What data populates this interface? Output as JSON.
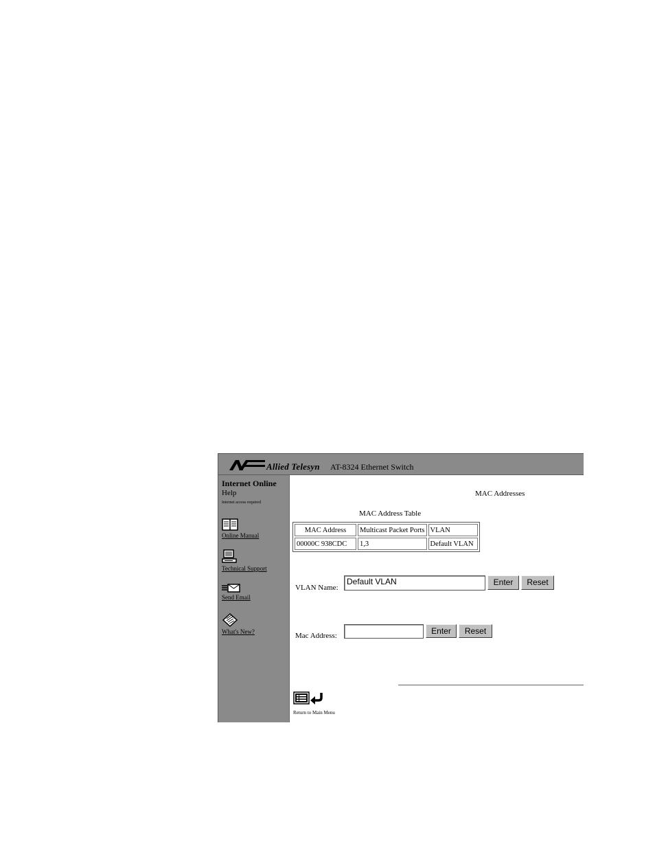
{
  "header": {
    "brand": "Allied Telesyn",
    "product": "AT-8324 Ethernet Switch"
  },
  "sidebar": {
    "title": "Internet Online",
    "subtitle": "Help",
    "note": "Internet access required",
    "items": [
      {
        "label": "Online Manual",
        "icon": "book-icon"
      },
      {
        "label": "Technical Support",
        "icon": "computer-icon"
      },
      {
        "label": "Send Email",
        "icon": "envelope-icon"
      },
      {
        "label": "What's New?",
        "icon": "news-icon"
      }
    ]
  },
  "main": {
    "title": "MAC Addresses",
    "table_caption": "MAC Address Table",
    "table": {
      "columns": [
        "MAC Address",
        "Multicast Packet Ports",
        "VLAN"
      ],
      "rows": [
        [
          "00000C 938CDC",
          "1,3",
          "Default VLAN"
        ]
      ]
    },
    "vlan_form": {
      "label": "VLAN Name:",
      "value": "Default VLAN",
      "enter_label": "Enter",
      "reset_label": "Reset"
    },
    "mac_form": {
      "label": "Mac Address:",
      "value": "",
      "enter_label": "Enter",
      "reset_label": "Reset"
    },
    "return_label": "Return to Main Menu"
  },
  "colors": {
    "panel": "#8a8a8a",
    "button": "#c0c0c0"
  }
}
